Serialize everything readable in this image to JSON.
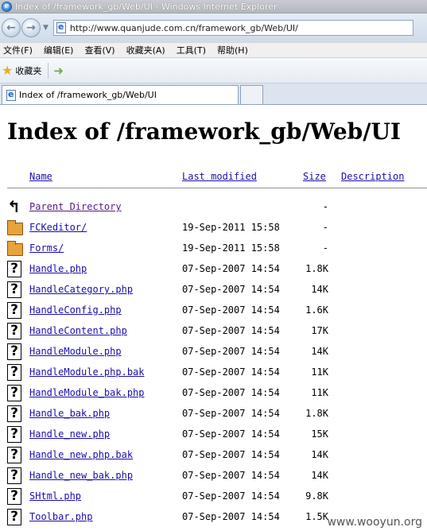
{
  "window": {
    "title": "Index of /framework_gb/Web/UI - Windows Internet Explorer"
  },
  "nav": {
    "address": "http://www.quanjude.com.cn/framework_gb/Web/UI/"
  },
  "menu": [
    "文件(F)",
    "编辑(E)",
    "查看(V)",
    "收藏夹(A)",
    "工具(T)",
    "帮助(H)"
  ],
  "favorites": {
    "label": "收藏夹"
  },
  "tab": {
    "label": "Index of /framework_gb/Web/UI"
  },
  "page": {
    "heading": "Index of /framework_gb/Web/UI",
    "columns": {
      "name": "Name",
      "modified": "Last modified",
      "size": "Size",
      "description": "Description"
    },
    "rows": [
      {
        "icon": "back-arrow-icon",
        "name": "Parent Directory",
        "modified": "",
        "size": "-"
      },
      {
        "icon": "folder-icon",
        "name": "FCKeditor/",
        "modified": "19-Sep-2011 15:58",
        "size": "-"
      },
      {
        "icon": "folder-icon",
        "name": "Forms/",
        "modified": "19-Sep-2011 15:58",
        "size": "-"
      },
      {
        "icon": "unknown-file-icon",
        "name": "Handle.php",
        "modified": "07-Sep-2007 14:54",
        "size": "1.8K"
      },
      {
        "icon": "unknown-file-icon",
        "name": "HandleCategory.php",
        "modified": "07-Sep-2007 14:54",
        "size": "14K"
      },
      {
        "icon": "unknown-file-icon",
        "name": "HandleConfig.php",
        "modified": "07-Sep-2007 14:54",
        "size": "1.6K"
      },
      {
        "icon": "unknown-file-icon",
        "name": "HandleContent.php",
        "modified": "07-Sep-2007 14:54",
        "size": "17K"
      },
      {
        "icon": "unknown-file-icon",
        "name": "HandleModule.php",
        "modified": "07-Sep-2007 14:54",
        "size": "14K"
      },
      {
        "icon": "unknown-file-icon",
        "name": "HandleModule.php.bak",
        "modified": "07-Sep-2007 14:54",
        "size": "11K"
      },
      {
        "icon": "unknown-file-icon",
        "name": "HandleModule_bak.php",
        "modified": "07-Sep-2007 14:54",
        "size": "11K"
      },
      {
        "icon": "unknown-file-icon",
        "name": "Handle_bak.php",
        "modified": "07-Sep-2007 14:54",
        "size": "1.8K"
      },
      {
        "icon": "unknown-file-icon",
        "name": "Handle_new.php",
        "modified": "07-Sep-2007 14:54",
        "size": "15K"
      },
      {
        "icon": "unknown-file-icon",
        "name": "Handle_new.php.bak",
        "modified": "07-Sep-2007 14:54",
        "size": "14K"
      },
      {
        "icon": "unknown-file-icon",
        "name": "Handle_new_bak.php",
        "modified": "07-Sep-2007 14:54",
        "size": "14K"
      },
      {
        "icon": "unknown-file-icon",
        "name": "SHtml.php",
        "modified": "07-Sep-2007 14:54",
        "size": "9.8K"
      },
      {
        "icon": "unknown-file-icon",
        "name": "Toolbar.php",
        "modified": "07-Sep-2007 14:54",
        "size": "1.5K"
      }
    ]
  },
  "watermark": "www.wooyun.org"
}
